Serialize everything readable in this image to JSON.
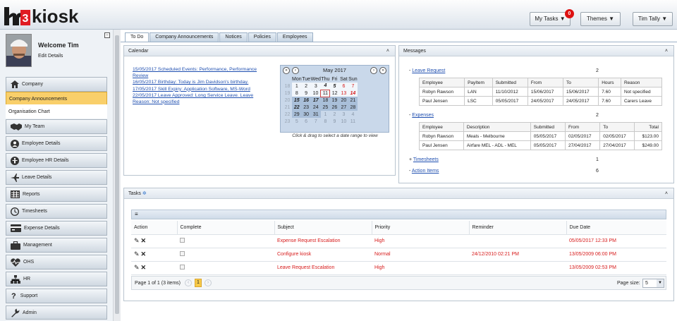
{
  "app": {
    "logo_text": "kiosk"
  },
  "topbar": {
    "my_tasks": "My Tasks ▼",
    "tasks_badge": "0",
    "themes": "Themes ▼",
    "user": "Tim Tally ▼"
  },
  "profile": {
    "welcome": "Welcome Tim",
    "edit": "Edit Details"
  },
  "sidebar": {
    "items": [
      "Company",
      "Company Announcements",
      "Organisation Chart",
      "My Team",
      "Employee Details",
      "Employee HR Details",
      "Leave Details",
      "Reports",
      "Timesheets",
      "Expense Details",
      "Management",
      "OHS",
      "HR",
      "Support",
      "Admin"
    ]
  },
  "tabs": [
    "To Do",
    "Company Announcements",
    "Notices",
    "Policies",
    "Employees"
  ],
  "calendar": {
    "title": "Calendar",
    "events": [
      "15/05/2017 Scheduled Events: Performance, Performance Review",
      "16/05/2017 Birthday: Today is Jim Davidson's birthday.",
      "17/05/2017 Skill Expiry: Application Software, MS-Word",
      "22/05/2017 Leave Approved: Long Service Leave. Leave Reason: Not specified"
    ],
    "month": "May 2017",
    "days": [
      "Mon",
      "Tue",
      "Wed",
      "Thu",
      "Fri",
      "Sat",
      "Sun"
    ],
    "weeks": [
      [
        "18",
        "1",
        "2",
        "3",
        "4",
        "5",
        "6",
        "7"
      ],
      [
        "19",
        "8",
        "9",
        "10",
        "11",
        "12",
        "13",
        "14"
      ],
      [
        "20",
        "15",
        "16",
        "17",
        "18",
        "19",
        "20",
        "21"
      ],
      [
        "21",
        "22",
        "23",
        "24",
        "25",
        "26",
        "27",
        "28"
      ],
      [
        "22",
        "29",
        "30",
        "31",
        "1",
        "2",
        "3",
        "4"
      ],
      [
        "23",
        "5",
        "6",
        "7",
        "8",
        "9",
        "10",
        "11"
      ]
    ],
    "hint": "Click & drag to select a date range to view"
  },
  "messages": {
    "title": "Messages",
    "leave": {
      "label": "Leave Request",
      "count": "2",
      "headers": [
        "Employee",
        "PayItem",
        "Submitted",
        "From",
        "To",
        "Hours",
        "Reason"
      ],
      "rows": [
        [
          "Robyn Rawson",
          "LAN",
          "11/10/2012",
          "15/06/2017",
          "15/06/2017",
          "7.60",
          "Not specified"
        ],
        [
          "Paul Jensen",
          "LSC",
          "05/05/2017",
          "24/05/2017",
          "24/05/2017",
          "7.60",
          "Carers Leave"
        ]
      ]
    },
    "expenses": {
      "label": "Expenses",
      "count": "2",
      "headers": [
        "Employee",
        "Description",
        "Submitted",
        "From",
        "To",
        "Total"
      ],
      "rows": [
        [
          "Robyn Rawson",
          "Meals - Melbourne",
          "05/05/2017",
          "02/05/2017",
          "02/05/2017",
          "$123.00"
        ],
        [
          "Paul Jensen",
          "Airfare MEL - ADL - MEL",
          "05/05/2017",
          "27/04/2017",
          "27/04/2017",
          "$249.00"
        ]
      ]
    },
    "timesheets": {
      "label": "Timesheets",
      "count": "1"
    },
    "actions": {
      "label": "Action Items",
      "count": "6"
    }
  },
  "tasks": {
    "title": "Tasks",
    "headers": [
      "Action",
      "Complete",
      "Subject",
      "Priority",
      "Reminder",
      "Due Date"
    ],
    "rows": [
      [
        "Expense Request Escalation",
        "High",
        "",
        "05/05/2017 12:33 PM"
      ],
      [
        "Configure kiosk",
        "Normal",
        "24/12/2010 02:21 PM",
        "13/05/2009 06:00 PM"
      ],
      [
        "Leave Request Escalation",
        "High",
        "",
        "13/05/2009 02:53 PM"
      ]
    ],
    "pager": "Page 1 of 1 (3 items)",
    "page": "1",
    "page_size_label": "Page size:",
    "page_size": "5"
  }
}
